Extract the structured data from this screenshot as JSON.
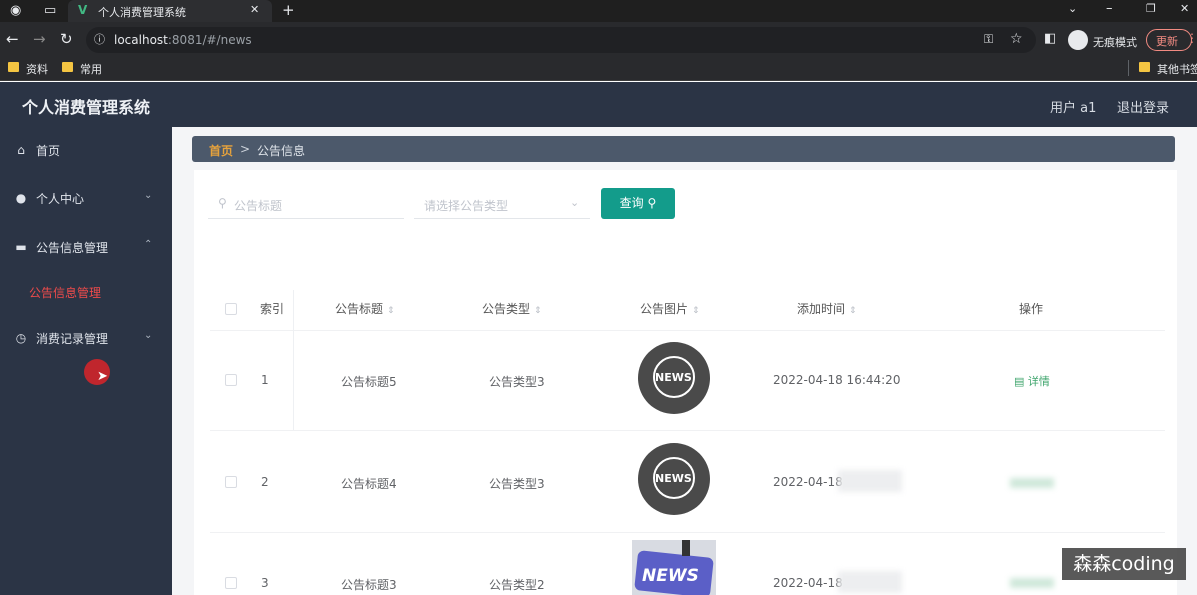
{
  "browser": {
    "tab_title": "个人消费管理系统",
    "url_host": "localhost",
    "url_rest": ":8081/#/news",
    "incognito_label": "无痕模式",
    "update_label": "更新",
    "bookmarks": [
      "资料",
      "常用"
    ],
    "bookmarks_right": "其他书签"
  },
  "app": {
    "title": "个人消费管理系统",
    "user_label": "用户 a1",
    "logout_label": "退出登录"
  },
  "sidebar": {
    "items": [
      {
        "label": "首页",
        "icon": "home-icon"
      },
      {
        "label": "个人中心",
        "icon": "user-icon"
      },
      {
        "label": "公告信息管理",
        "icon": "briefcase-icon"
      },
      {
        "label": "消费记录管理",
        "icon": "clock-icon"
      }
    ],
    "active_sub": "公告信息管理"
  },
  "breadcrumb": {
    "home": "首页",
    "separator": ">",
    "current": "公告信息"
  },
  "search": {
    "title_placeholder": "公告标题",
    "type_placeholder": "请选择公告类型",
    "query_label": "查询"
  },
  "table": {
    "headers": [
      "索引",
      "公告标题",
      "公告类型",
      "公告图片",
      "添加时间",
      "操作"
    ],
    "rows": [
      {
        "index": "1",
        "title": "公告标题5",
        "type": "公告类型3",
        "time": "2022-04-18 16:44:20",
        "action": "详情"
      },
      {
        "index": "2",
        "title": "公告标题4",
        "type": "公告类型3",
        "time": "2022-04-18"
      },
      {
        "index": "3",
        "title": "公告标题3",
        "type": "公告类型2",
        "time": "2022-04-18"
      }
    ],
    "image_label": "NEWS"
  },
  "watermark": "森森coding",
  "colors": {
    "header_bg": "#2b3445",
    "accent": "#139c8b",
    "active_menu": "#ef4b4b",
    "breadcrumb_home": "#e6a23c"
  }
}
